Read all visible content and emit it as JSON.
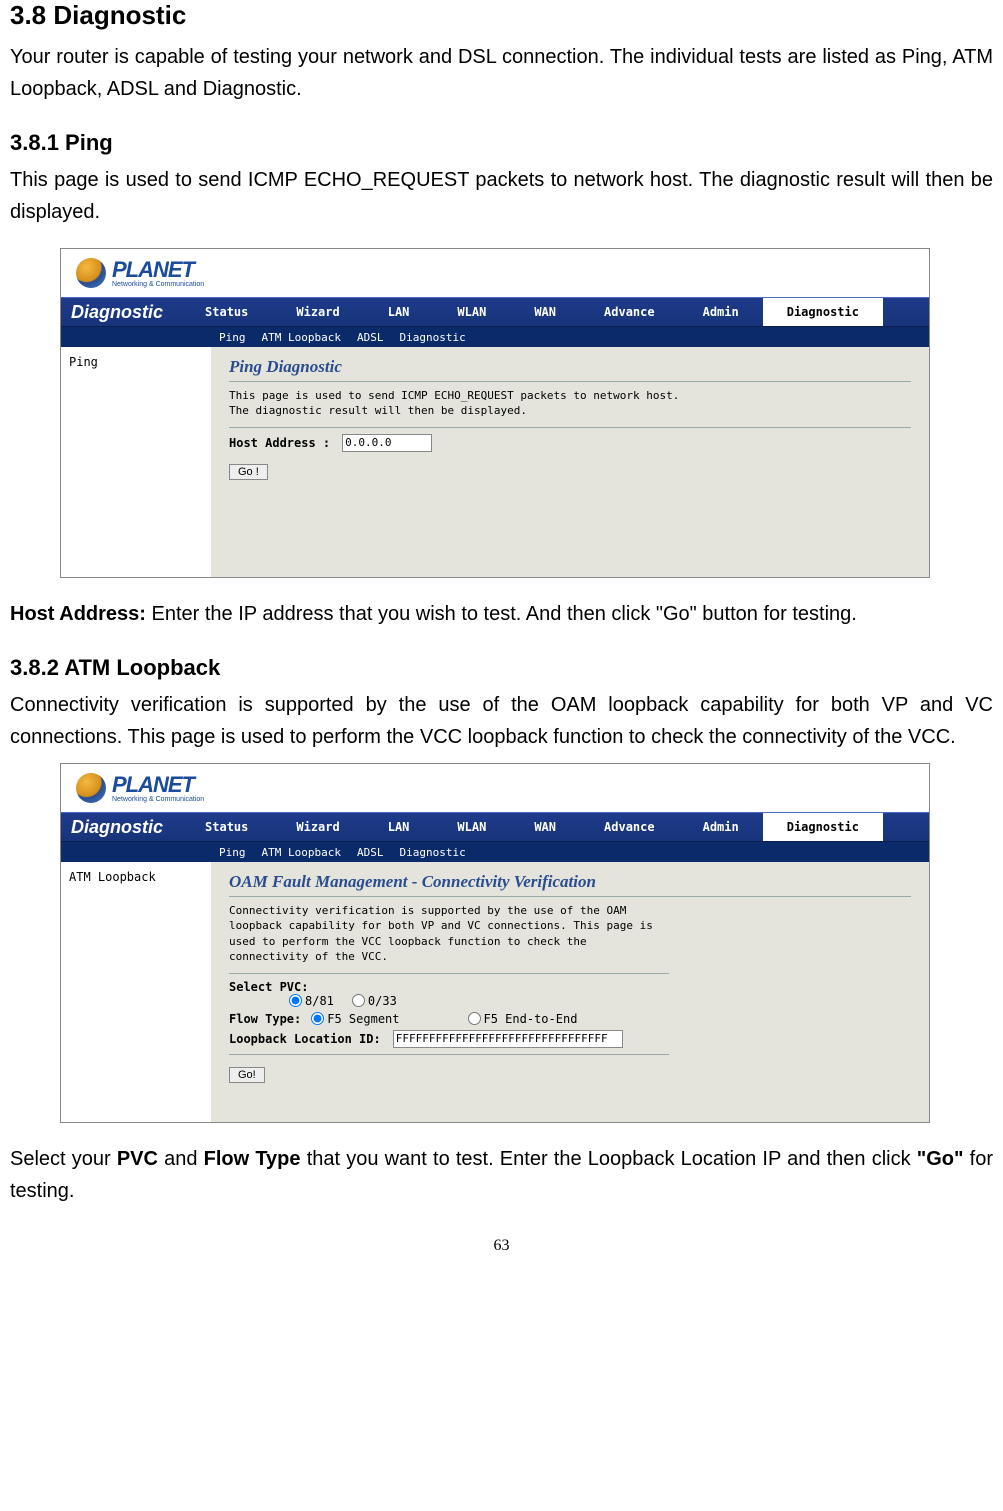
{
  "section": {
    "title": "3.8 Diagnostic",
    "intro": "Your router is capable of testing your network and DSL connection. The individual tests are listed as Ping, ATM Loopback, ADSL and Diagnostic."
  },
  "ping": {
    "heading": "3.8.1 Ping",
    "desc": "This page is used to send ICMP ECHO_REQUEST packets to network host. The diagnostic result will then be displayed.",
    "post_label": "Host Address: ",
    "post_text": "Enter the IP address that you wish to test. And then click \"Go\" button for testing."
  },
  "atm": {
    "heading": "3.8.2 ATM Loopback",
    "desc": "Connectivity verification is supported by the use of the OAM loopback capability for both VP and VC connections. This page is used to perform the VCC loopback function to check the connectivity of the VCC.",
    "post_pre": "Select your ",
    "post_b1": "PVC",
    "post_mid1": " and ",
    "post_b2": "Flow Type",
    "post_mid2": " that you want to test. Enter the Loopback Location IP and then click ",
    "post_b3": "\"Go\"",
    "post_end": " for testing."
  },
  "brand": {
    "name": "PLANET",
    "tag": "Networking & Communication"
  },
  "nav": {
    "title": "Diagnostic",
    "items": [
      "Status",
      "Wizard",
      "LAN",
      "WLAN",
      "WAN",
      "Advance",
      "Admin",
      "Diagnostic"
    ],
    "sub": [
      "Ping",
      "ATM Loopback",
      "ADSL",
      "Diagnostic"
    ]
  },
  "ss1": {
    "side": "Ping",
    "title": "Ping Diagnostic",
    "desc1": "This page is used to send ICMP ECHO_REQUEST packets to network host.",
    "desc2": "The diagnostic result will then be displayed.",
    "host_label": "Host Address :",
    "host_value": "0.0.0.0",
    "go": "Go !"
  },
  "ss2": {
    "side": "ATM Loopback",
    "title": "OAM Fault Management - Connectivity Verification",
    "desc": "Connectivity verification is supported by the use of the OAM loopback capability for both VP and VC connections. This page is used to perform the VCC loopback function to check the connectivity of the VCC.",
    "select_pvc": "Select PVC:",
    "pvc1": "8/81",
    "pvc2": "0/33",
    "flow_label": "Flow Type:",
    "flow1": "F5 Segment",
    "flow2": "F5 End-to-End",
    "loc_label": "Loopback Location ID:",
    "loc_value": "FFFFFFFFFFFFFFFFFFFFFFFFFFFFFFFF",
    "go": "Go!"
  },
  "pagenum": "63"
}
